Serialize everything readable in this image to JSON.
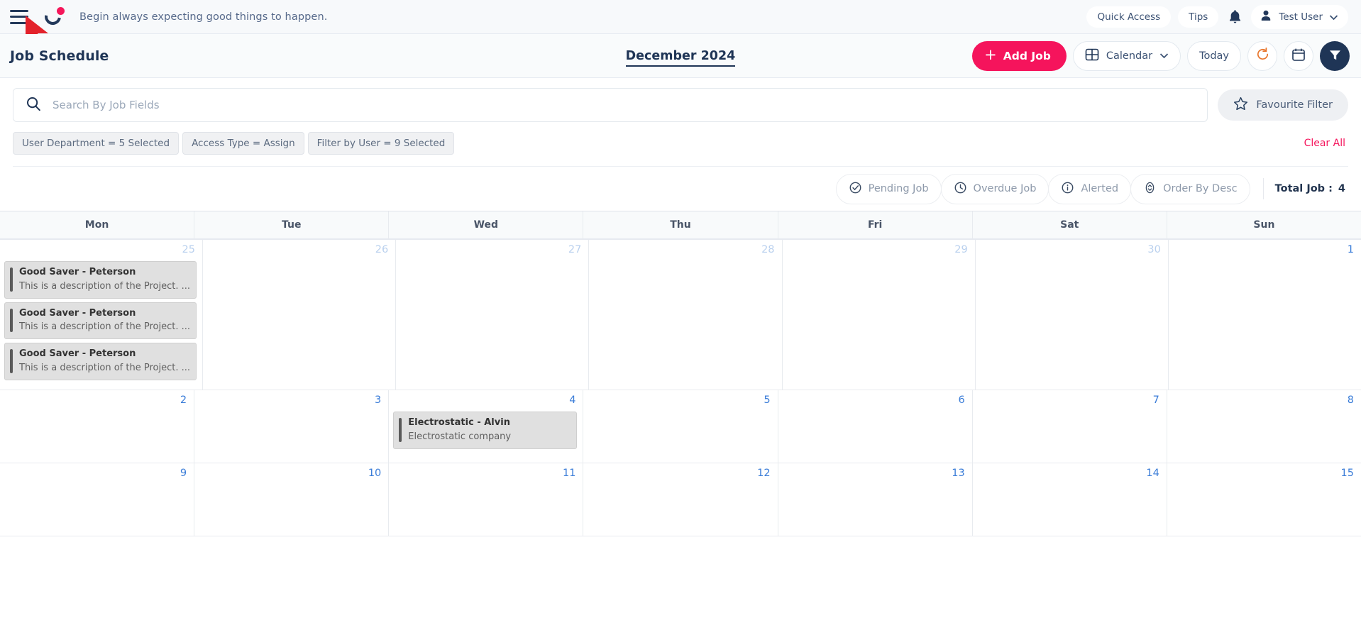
{
  "topbar": {
    "menu_icon": "hamburger-menu-icon",
    "logo_icon": "brand-logo-icon",
    "tagline": "Begin always expecting good things to happen.",
    "quick_access_label": "Quick Access",
    "tips_label": "Tips",
    "bell_icon": "notification-bell-icon",
    "avatar_icon": "user-avatar-icon",
    "user_name": "Test User",
    "chevron_icon": "chevron-down-icon"
  },
  "header": {
    "page_title": "Job Schedule",
    "month_label": "December 2024",
    "add_job_label": "Add Job",
    "add_job_plus": "+",
    "view_label": "Calendar",
    "view_icon": "grid-view-icon",
    "view_chevron": "chevron-down-icon",
    "today_label": "Today",
    "refresh_icon": "refresh-icon",
    "date_picker_icon": "calendar-icon",
    "filter_icon": "funnel-filter-icon",
    "accent_pink": "#f5145c",
    "accent_navy": "#1f3556",
    "accent_orange": "#e8762c"
  },
  "search": {
    "icon": "search-icon",
    "value": "",
    "placeholder": "Search By Job Fields",
    "favourite_filter_label": "Favourite Filter",
    "star_icon": "star-icon"
  },
  "filters": {
    "chips": [
      "User Department  =  5 Selected",
      "Access Type  =  Assign",
      "Filter by User  =  9 Selected"
    ],
    "clear_all_label": "Clear All",
    "clear_all_color": "#f5145c"
  },
  "status": {
    "items": [
      {
        "label": "Pending Job",
        "icon": "check-circle-icon"
      },
      {
        "label": "Overdue Job",
        "icon": "clock-icon"
      },
      {
        "label": "Alerted",
        "icon": "info-circle-icon"
      },
      {
        "label": "Order By Desc",
        "icon": "sort-updown-icon"
      }
    ],
    "total_label": "Total Job :",
    "total_value": "4"
  },
  "calendar": {
    "weekday_headers": [
      "Mon",
      "Tue",
      "Wed",
      "Thu",
      "Fri",
      "Sat",
      "Sun"
    ],
    "weeks": [
      {
        "tall": true,
        "days": [
          {
            "num": "25",
            "muted": true,
            "events": [
              {
                "title": "Good Saver - Peterson",
                "desc": "This is a description of the Project. ..."
              },
              {
                "title": "Good Saver - Peterson",
                "desc": "This is a description of the Project. ..."
              },
              {
                "title": "Good Saver - Peterson",
                "desc": "This is a description of the Project. ..."
              }
            ]
          },
          {
            "num": "26",
            "muted": true,
            "events": []
          },
          {
            "num": "27",
            "muted": true,
            "events": []
          },
          {
            "num": "28",
            "muted": true,
            "events": []
          },
          {
            "num": "29",
            "muted": true,
            "events": []
          },
          {
            "num": "30",
            "muted": true,
            "events": []
          },
          {
            "num": "1",
            "muted": false,
            "events": []
          }
        ]
      },
      {
        "tall": false,
        "days": [
          {
            "num": "2",
            "muted": false,
            "events": []
          },
          {
            "num": "3",
            "muted": false,
            "events": []
          },
          {
            "num": "4",
            "muted": false,
            "events": [
              {
                "title": "Electrostatic - Alvin",
                "desc": "Electrostatic company"
              }
            ]
          },
          {
            "num": "5",
            "muted": false,
            "events": []
          },
          {
            "num": "6",
            "muted": false,
            "events": []
          },
          {
            "num": "7",
            "muted": false,
            "events": []
          },
          {
            "num": "8",
            "muted": false,
            "events": []
          }
        ]
      },
      {
        "tall": false,
        "days": [
          {
            "num": "9",
            "muted": false,
            "events": []
          },
          {
            "num": "10",
            "muted": false,
            "events": []
          },
          {
            "num": "11",
            "muted": false,
            "events": []
          },
          {
            "num": "12",
            "muted": false,
            "events": []
          },
          {
            "num": "13",
            "muted": false,
            "events": []
          },
          {
            "num": "14",
            "muted": false,
            "events": []
          },
          {
            "num": "15",
            "muted": false,
            "events": []
          }
        ]
      }
    ]
  }
}
